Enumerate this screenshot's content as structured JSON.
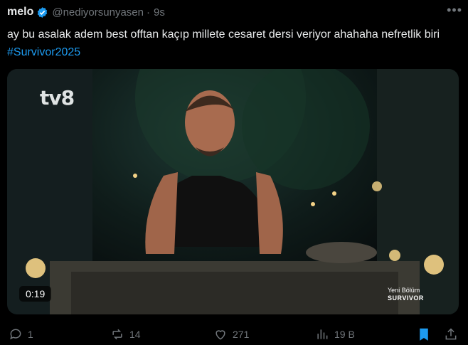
{
  "tweet": {
    "display_name": "melo",
    "handle": "@nediyorsunyasen",
    "separator": "·",
    "time": "9s",
    "more_label": "•••",
    "text": "ay bu asalak adem best offtan kaçıp millete cesaret dersi veriyor ahahaha nefretlik biri ",
    "hashtag": "#Survivor2025"
  },
  "media": {
    "channel_logo": "tv8",
    "duration": "0:19",
    "promo_line1": "Yeni Bölüm",
    "promo_line2": "SURVIVOR"
  },
  "actions": {
    "replies": "1",
    "reposts": "14",
    "likes": "271",
    "views": "19 B"
  },
  "icons": {
    "verified": "verified-badge-icon",
    "reply": "reply-icon",
    "repost": "repost-icon",
    "like": "heart-icon",
    "views": "views-chart-icon",
    "bookmark": "bookmark-icon",
    "share": "share-icon"
  },
  "colors": {
    "background": "#000000",
    "text": "#e7e9ea",
    "muted": "#71767b",
    "accent": "#1d9bf0"
  }
}
